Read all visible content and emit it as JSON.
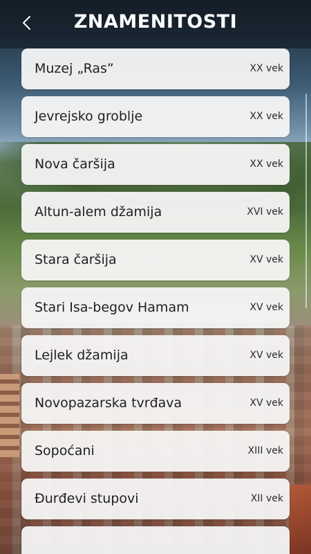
{
  "header": {
    "title": "ZNAMENITOSTI",
    "back_icon": "chevron-left-icon"
  },
  "sights": [
    {
      "name": "Muzej „Ras”",
      "century": "XX vek"
    },
    {
      "name": "Jevrejsko groblje",
      "century": "XX vek"
    },
    {
      "name": "Nova čaršija",
      "century": "XX vek"
    },
    {
      "name": "Altun-alem džamija",
      "century": "XVI vek"
    },
    {
      "name": "Stara čaršija",
      "century": "XV vek"
    },
    {
      "name": "Stari Isa-begov Hamam",
      "century": "XV vek"
    },
    {
      "name": "Lejlek džamija",
      "century": "XV vek"
    },
    {
      "name": "Novopazarska tvrđava",
      "century": "XV vek"
    },
    {
      "name": "Sopoćani",
      "century": "XIII vek"
    },
    {
      "name": "Đurđevi stupovi",
      "century": "XII vek"
    }
  ],
  "colors": {
    "card_bg": "#f6f6f6",
    "title": "#ffffff",
    "text": "#1f1f1f"
  }
}
